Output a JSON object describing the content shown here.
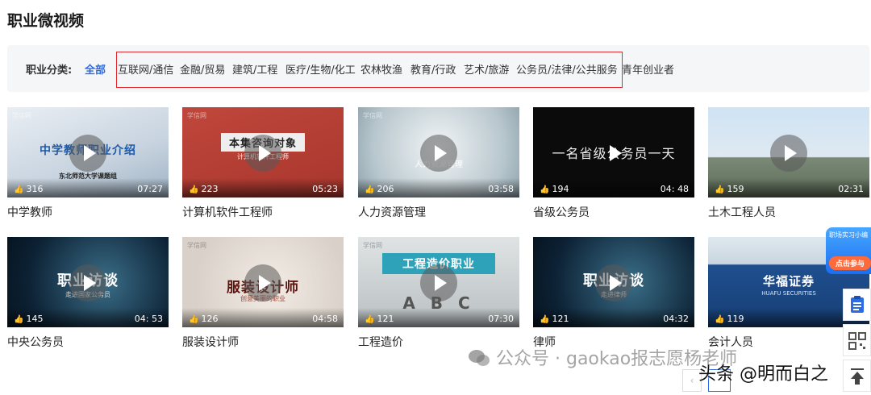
{
  "page": {
    "title": "职业微视频"
  },
  "filter": {
    "label": "职业分类:",
    "items": [
      "全部",
      "互联网/通信",
      "金融/贸易",
      "建筑/工程",
      "医疗/生物/化工",
      "农林牧渔",
      "教育/行政",
      "艺术/旅游",
      "公务员/法律/公共服务",
      "青年创业者"
    ],
    "active_index": 0,
    "highlight_color": "#e0282e"
  },
  "videos": [
    {
      "title": "中学教师",
      "likes": "316",
      "duration": "07:27",
      "thumb_title": "中学教师职业介绍",
      "thumb_sub": "东北师范大学课题组",
      "watermark": "学信网"
    },
    {
      "title": "计算机软件工程师",
      "likes": "223",
      "duration": "05:23",
      "thumb_title": "本集咨询对象",
      "thumb_sub": "计算机软件工程师",
      "watermark": "学信网"
    },
    {
      "title": "人力资源管理",
      "likes": "206",
      "duration": "03:58",
      "thumb_title": "",
      "thumb_sub": "人力资源管理",
      "watermark": "学信网"
    },
    {
      "title": "省级公务员",
      "likes": "194",
      "duration": "04: 48",
      "thumb_title": "一名省级公务员一天",
      "thumb_sub": "",
      "watermark": ""
    },
    {
      "title": "土木工程人员",
      "likes": "159",
      "duration": "02:31",
      "thumb_title": "",
      "thumb_sub": "",
      "watermark": ""
    },
    {
      "title": "中央公务员",
      "likes": "145",
      "duration": "04: 53",
      "thumb_title": "职业访谈",
      "thumb_sub": "走进国家公务员",
      "watermark": ""
    },
    {
      "title": "服装设计师",
      "likes": "126",
      "duration": "04:58",
      "thumb_title": "服装设计师",
      "thumb_sub": "创意美丽的职业",
      "watermark": "学信网"
    },
    {
      "title": "工程造价",
      "likes": "121",
      "duration": "07:30",
      "thumb_title": "工程造价职业",
      "thumb_sub": "A  B  C",
      "watermark": "学信网"
    },
    {
      "title": "律师",
      "likes": "121",
      "duration": "04:32",
      "thumb_title": "职业访谈",
      "thumb_sub": "走进律师",
      "watermark": ""
    },
    {
      "title": "会计人员",
      "likes": "119",
      "duration": "",
      "thumb_title": "华福证券",
      "thumb_sub": "HUAFU SECURITIES",
      "watermark": ""
    }
  ],
  "side": {
    "promo_top": "职场实习小编",
    "promo_cta": "点击参与",
    "doc_icon": "document-icon",
    "qr_icon": "qr-code-icon",
    "top_icon": "back-to-top-icon"
  },
  "overlay": {
    "wechat_watermark": "公众号 · gaokao报志愿杨老师",
    "toutiao_watermark": "头条 @明而白之"
  },
  "colors": {
    "accent": "#2d6be4",
    "highlight": "#e0282e"
  }
}
